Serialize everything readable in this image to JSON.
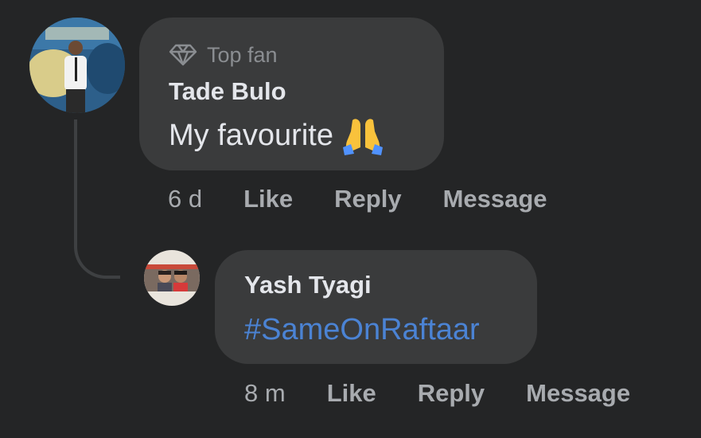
{
  "comments": [
    {
      "badge": "Top fan",
      "badge_icon": "diamond-icon",
      "author": "Tade Bulo",
      "text": "My favourite",
      "emoji": "folded-hands-emoji",
      "time": "6 d",
      "actions": {
        "like": "Like",
        "reply": "Reply",
        "message": "Message"
      }
    },
    {
      "author": "Yash Tyagi",
      "text": "#SameOnRaftaar",
      "time": "8 m",
      "actions": {
        "like": "Like",
        "reply": "Reply",
        "message": "Message"
      }
    }
  ],
  "colors": {
    "background": "#242526",
    "bubble": "#3a3b3c",
    "primary_text": "#e4e6eb",
    "secondary_text": "#a8abaf",
    "hashtag": "#4b83d4"
  }
}
